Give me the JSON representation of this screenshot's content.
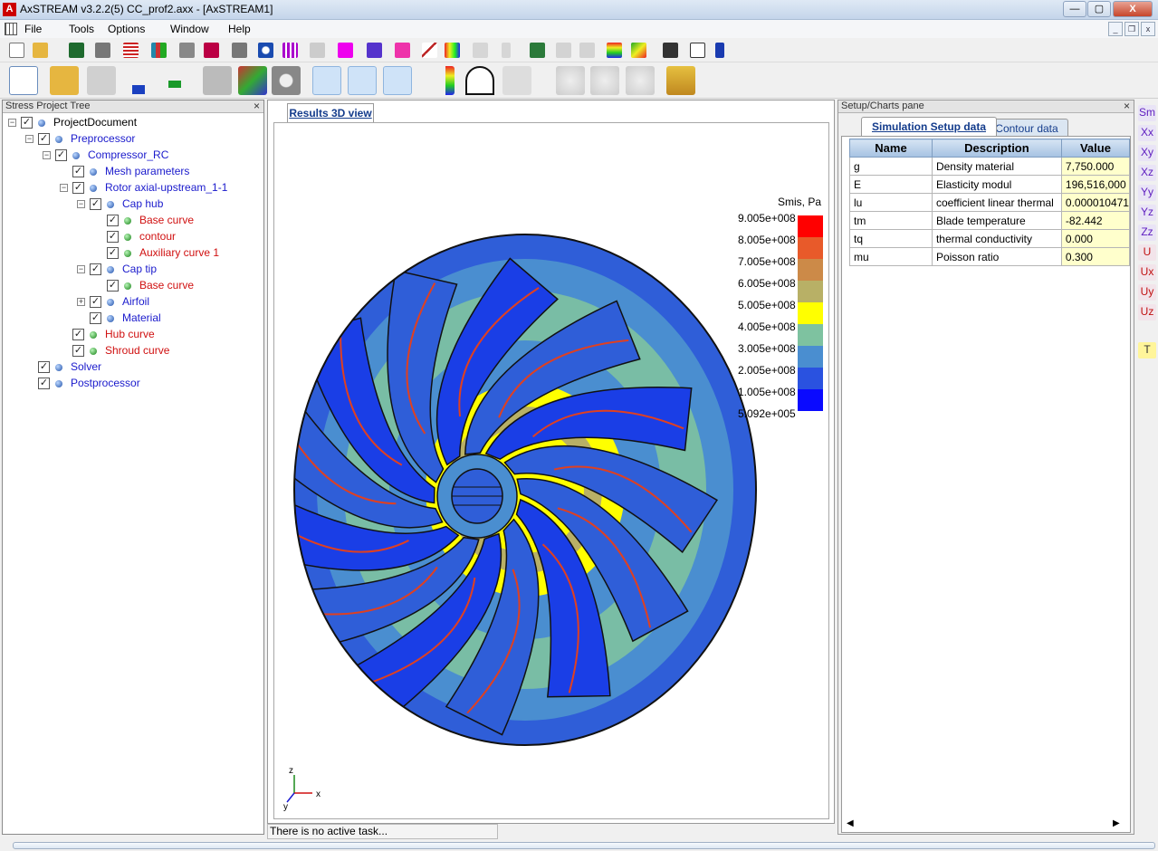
{
  "window": {
    "app_icon": "A",
    "title": "AxSTREAM  v3.2.2(5)    CC_prof2.axx - [AxSTREAM1]",
    "minimize": "—",
    "maximize": "▢",
    "close": "X"
  },
  "menu": {
    "items": [
      "File",
      "Tools",
      "Options",
      "Window",
      "Help"
    ],
    "mdi": {
      "minimize": "_",
      "restore": "❐",
      "close": "x"
    }
  },
  "tree": {
    "title": "Stress Project Tree",
    "close": "×",
    "nodes": [
      {
        "label": "ProjectDocument",
        "color": "black"
      },
      {
        "label": "Preprocessor",
        "color": "blue"
      },
      {
        "label": "Compressor_RC",
        "color": "blue"
      },
      {
        "label": "Mesh parameters",
        "color": "blue"
      },
      {
        "label": "Rotor axial-upstream_1-1",
        "color": "blue"
      },
      {
        "label": "Cap hub",
        "color": "blue"
      },
      {
        "label": "Base curve",
        "color": "red"
      },
      {
        "label": "contour",
        "color": "red"
      },
      {
        "label": "Auxiliary curve 1",
        "color": "red"
      },
      {
        "label": "Cap tip",
        "color": "blue"
      },
      {
        "label": "Base curve",
        "color": "red"
      },
      {
        "label": "Airfoil",
        "color": "blue"
      },
      {
        "label": "Material",
        "color": "blue"
      },
      {
        "label": "Hub curve",
        "color": "red"
      },
      {
        "label": "Shroud curve",
        "color": "red"
      },
      {
        "label": "Solver",
        "color": "blue"
      },
      {
        "label": "Postprocessor",
        "color": "blue"
      }
    ]
  },
  "view": {
    "tab_label": "Results 3D view",
    "legend": {
      "title": "Smis, Pa",
      "labels": [
        "9.005e+008",
        "8.005e+008",
        "7.005e+008",
        "6.005e+008",
        "5.005e+008",
        "4.005e+008",
        "3.005e+008",
        "2.005e+008",
        "1.005e+008",
        "5.092e+005"
      ],
      "colors": [
        "#ff0000",
        "#e85a2a",
        "#cc8a48",
        "#b8b066",
        "#ffff00",
        "#7ec2a0",
        "#4a8ed0",
        "#2a52e0",
        "#0a0aff"
      ]
    },
    "axis": {
      "z": "z",
      "y": "y",
      "x": "x"
    }
  },
  "status": {
    "text": "There is no active task..."
  },
  "setup": {
    "title": "Setup/Charts pane",
    "close": "×",
    "tabs": [
      "Simulation Setup data",
      "Contour data"
    ],
    "columns": [
      "Name",
      "Description",
      "Value"
    ],
    "rows": [
      {
        "name": "g",
        "description": "Density material",
        "value": "7,750.000"
      },
      {
        "name": "E",
        "description": "Elasticity modul",
        "value": "196,516,000"
      },
      {
        "name": "lu",
        "description": "coefficient linear thermal",
        "value": "0.000010471"
      },
      {
        "name": "tm",
        "description": "Blade temperature",
        "value": "-82.442"
      },
      {
        "name": "tq",
        "description": "thermal conductivity",
        "value": "0.000"
      },
      {
        "name": "mu",
        "description": "Poisson ratio",
        "value": "0.300"
      }
    ],
    "scroll_left": "◀",
    "scroll_right": "▶"
  },
  "result_toolbar": [
    {
      "label": "Sm",
      "style": "purple"
    },
    {
      "label": "Xx",
      "style": "purple"
    },
    {
      "label": "Xy",
      "style": "purple"
    },
    {
      "label": "Xz",
      "style": "purple"
    },
    {
      "label": "Yy",
      "style": "purple"
    },
    {
      "label": "Yz",
      "style": "purple"
    },
    {
      "label": "Zz",
      "style": "purple"
    },
    {
      "label": "U",
      "style": "red"
    },
    {
      "label": "Ux",
      "style": "red"
    },
    {
      "label": "Uy",
      "style": "red"
    },
    {
      "label": "Uz",
      "style": "red"
    },
    {
      "label": "T",
      "style": "yellow"
    }
  ]
}
